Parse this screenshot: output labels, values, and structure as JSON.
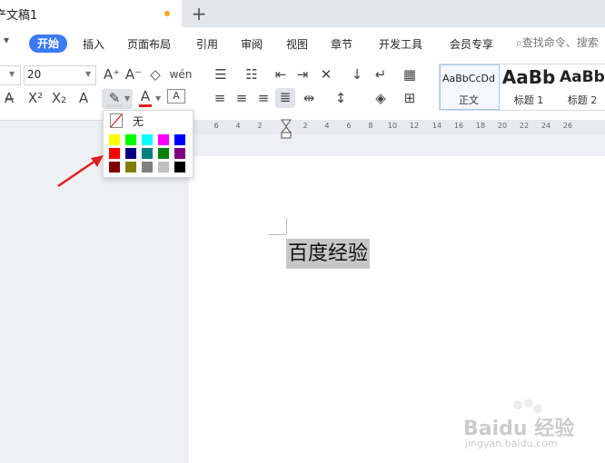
{
  "tab": {
    "title": "文稿1",
    "title_prefix": "产",
    "new_tab": "+"
  },
  "menu": {
    "more": "▾",
    "active": "开始",
    "items": [
      "插入",
      "页面布局",
      "引用",
      "审阅",
      "视图",
      "章节",
      "开发工具",
      "会员专享"
    ],
    "search_text": "查找命令、搜索"
  },
  "ribbon": {
    "font_size": "20",
    "row1_icons": [
      "A⁺",
      "A⁻",
      "◇",
      "wén"
    ],
    "row2_icons": [
      "A̶",
      "X²",
      "X₂",
      "A",
      "A",
      "A"
    ],
    "paragraph_icons_row1": [
      "☰",
      "☷",
      "⇤",
      "⇥",
      "✕",
      "↓",
      "↵",
      "▦"
    ],
    "paragraph_icons_row2": [
      "≡",
      "≡",
      "≡",
      "≣",
      "⇹",
      "↕",
      "◈",
      "⊞"
    ]
  },
  "styles": [
    {
      "sample": "AaBbCcDd",
      "label": "正文"
    },
    {
      "sample": "AaBb",
      "label": "标题 1"
    },
    {
      "sample": "AaBb",
      "label": "标题 2"
    }
  ],
  "ruler": {
    "numbers": [
      "6",
      "4",
      "2",
      "2",
      "4",
      "6",
      "8",
      "10",
      "12",
      "14",
      "16",
      "18",
      "20",
      "22",
      "24",
      "26"
    ]
  },
  "document": {
    "text": "百度经验"
  },
  "highlight_popup": {
    "none_label": "无",
    "colors": [
      "#ffff00",
      "#00ff00",
      "#00ffff",
      "#ff00ff",
      "#0000ff",
      "#ff0000",
      "#000080",
      "#008080",
      "#008000",
      "#800080",
      "#800000",
      "#808000",
      "#808080",
      "#c0c0c0",
      "#000000"
    ]
  },
  "annotation_color": "#e02020",
  "watermark": {
    "text": "Baidu 经验",
    "url": "jingyan.baidu.com"
  }
}
